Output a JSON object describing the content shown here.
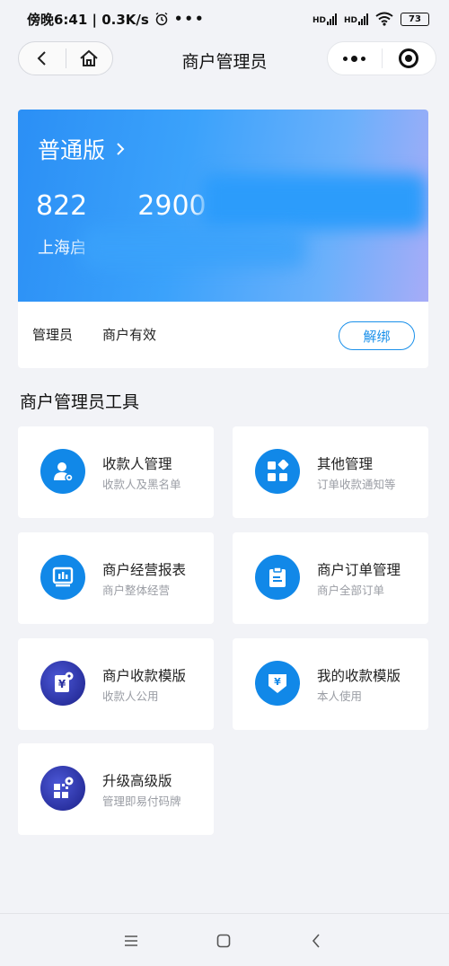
{
  "status_bar": {
    "time": "傍晚6:41 | 0.3K/s",
    "network_1": "HD",
    "network_2": "HD",
    "battery": "73"
  },
  "nav": {
    "title": "商户管理员"
  },
  "merchant": {
    "plan": "普通版",
    "id_part_1": "822",
    "id_part_2": "2900",
    "name": "上海启",
    "role": "管理员",
    "status": "商户有效",
    "unbind_label": "解绑"
  },
  "tools": {
    "section_title": "商户管理员工具",
    "items": [
      {
        "name": "收款人管理",
        "desc": "收款人及黑名单",
        "icon": "payee-icon"
      },
      {
        "name": "其他管理",
        "desc": "订单收款通知等",
        "icon": "grid-icon"
      },
      {
        "name": "商户经营报表",
        "desc": "商户整体经营",
        "icon": "report-icon"
      },
      {
        "name": "商户订单管理",
        "desc": "商户全部订单",
        "icon": "clipboard-icon"
      },
      {
        "name": "商户收款模版",
        "desc": "收款人公用",
        "icon": "merchant-template-icon"
      },
      {
        "name": "我的收款模版",
        "desc": "本人使用",
        "icon": "my-template-icon"
      },
      {
        "name": "升级高级版",
        "desc": "管理即易付码牌",
        "icon": "upgrade-icon"
      }
    ]
  },
  "colors": {
    "accent": "#1188e8",
    "banner_start": "#2b8ff5",
    "banner_end": "#a7acf7",
    "premium_icon": "#2a31a0"
  }
}
